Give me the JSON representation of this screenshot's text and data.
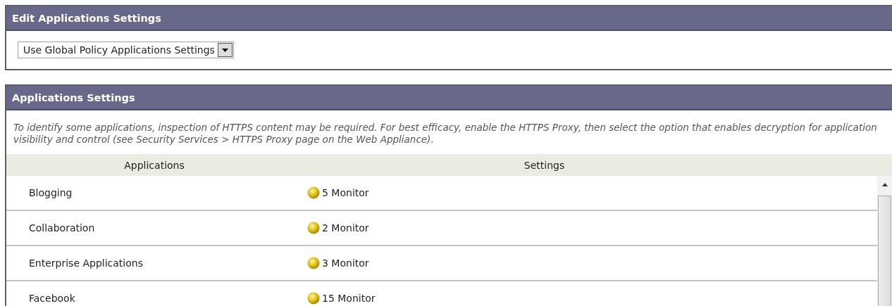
{
  "edit_panel": {
    "title": "Edit Applications Settings",
    "dropdown": {
      "value": "Use Global Policy Applications Settings"
    }
  },
  "settings_panel": {
    "title": "Applications Settings",
    "description": "To identify some applications, inspection of HTTPS content may be required. For best efficacy, enable the HTTPS Proxy, then select the option that enables decryption for application visibility and control (see Security Services > HTTPS Proxy page on the Web Appliance).",
    "table": {
      "columns": [
        "Applications",
        "Settings"
      ],
      "rows": [
        {
          "application": "Blogging",
          "setting": "5 Monitor"
        },
        {
          "application": "Collaboration",
          "setting": "2 Monitor"
        },
        {
          "application": "Enterprise Applications",
          "setting": "3 Monitor"
        },
        {
          "application": "Facebook",
          "setting": "15 Monitor"
        }
      ]
    }
  }
}
